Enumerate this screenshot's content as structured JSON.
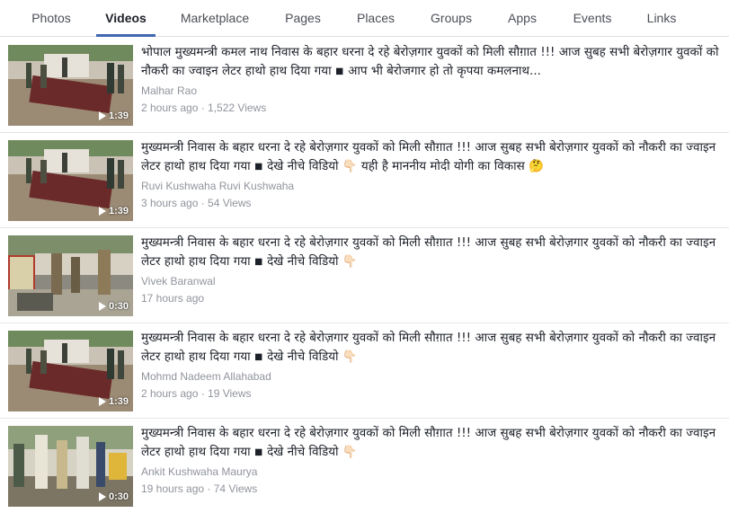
{
  "tabs": [
    {
      "label": "Photos",
      "active": false
    },
    {
      "label": "Videos",
      "active": true
    },
    {
      "label": "Marketplace",
      "active": false
    },
    {
      "label": "Pages",
      "active": false
    },
    {
      "label": "Places",
      "active": false
    },
    {
      "label": "Groups",
      "active": false
    },
    {
      "label": "Apps",
      "active": false
    },
    {
      "label": "Events",
      "active": false
    },
    {
      "label": "Links",
      "active": false
    }
  ],
  "videos": [
    {
      "title": "भोपाल मुख्यमन्त्री कमल नाथ निवास के बहार धरना दे रहे बेरोज़गार युवकों को मिली सौग़ात !!! आज सुबह सभी बेरोज़गार युवकों को नौकरी का ज्वाइन लेटर हाथो हाथ दिया गया ◾ आप भी बेरोजगार हो तो कृपया कमलनाथ...",
      "author": "Malhar Rao",
      "meta": "2 hours ago · 1,522 Views",
      "duration": "1:39"
    },
    {
      "title": "मुख्यमन्त्री निवास के बहार धरना दे रहे बेरोज़गार युवकों को मिली सौग़ात !!! आज सुबह सभी बेरोज़गार युवकों को नौकरी का ज्वाइन लेटर हाथो हाथ दिया गया ◾ देखे नीचे विडियो 👇🏻 यही है माननीय मोदी योगी का विकास 🤔",
      "author": "Ruvi Kushwaha Ruvi Kushwaha",
      "meta": "3 hours ago · 54 Views",
      "duration": "1:39"
    },
    {
      "title": "मुख्यमन्त्री निवास के बहार धरना दे रहे बेरोज़गार युवकों को मिली सौग़ात !!! आज सुबह सभी बेरोज़गार युवकों को नौकरी का ज्वाइन लेटर हाथो हाथ दिया गया ◾ देखे नीचे विडियो 👇🏻",
      "author": "Vivek Baranwal",
      "meta": "17 hours ago",
      "duration": "0:30"
    },
    {
      "title": "मुख्यमन्त्री निवास के बहार धरना दे रहे बेरोज़गार युवकों को मिली सौग़ात !!! आज सुबह सभी बेरोज़गार युवकों को नौकरी का ज्वाइन लेटर हाथो हाथ दिया गया ◾ देखे नीचे विडियो 👇🏻",
      "author": "Mohmd Nadeem Allahabad",
      "meta": "2 hours ago · 19 Views",
      "duration": "1:39"
    },
    {
      "title": "मुख्यमन्त्री निवास के बहार धरना दे रहे बेरोज़गार युवकों को मिली सौग़ात !!! आज सुबह सभी बेरोज़गार युवकों को नौकरी का ज्वाइन लेटर हाथो हाथ दिया गया ◾ देखे नीचे विडियो 👇🏻",
      "author": "Ankit Kushwaha Maurya",
      "meta": "19 hours ago · 74 Views",
      "duration": "0:30"
    }
  ],
  "colors": {
    "active_tab_underline": "#4267b2",
    "secondary_text": "#90949c",
    "primary_text": "#1d2129"
  }
}
